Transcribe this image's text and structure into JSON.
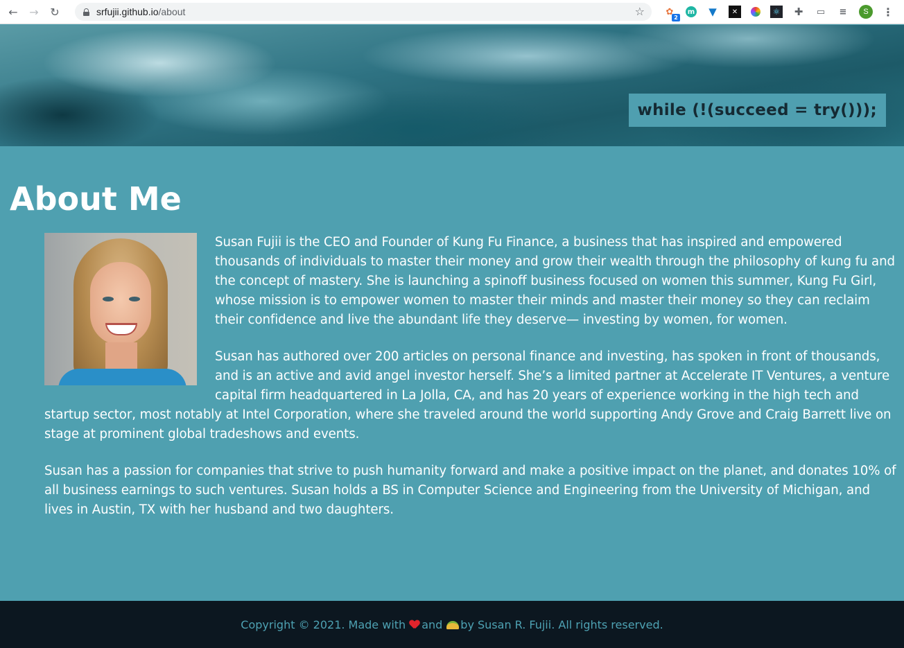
{
  "browser": {
    "back_label": "←",
    "forward_label": "→",
    "reload_label": "↻",
    "url_host": "srfujii.github.io",
    "url_path": "/about",
    "star_icon": "☆",
    "extensions": [
      {
        "name": "extension-1-icon",
        "glyph": "✿",
        "badge": "2"
      },
      {
        "name": "extension-m-icon",
        "glyph": "m"
      },
      {
        "name": "extension-vue-icon",
        "glyph": "▼"
      },
      {
        "name": "extension-x-icon",
        "glyph": "✕"
      },
      {
        "name": "extension-color-icon",
        "glyph": ""
      },
      {
        "name": "extension-react-icon",
        "glyph": "⚛"
      },
      {
        "name": "extensions-puzzle-icon",
        "glyph": "✚"
      },
      {
        "name": "cast-icon",
        "glyph": "▭"
      },
      {
        "name": "media-icon",
        "glyph": "≡"
      }
    ],
    "profile_initial": "S",
    "menu_label": "⋮"
  },
  "header": {
    "motto": "while (!(succeed = try()));"
  },
  "main": {
    "title": "About Me",
    "paragraphs": [
      "Susan Fujii is the CEO and Founder of Kung Fu Finance, a business that has inspired and empowered thousands of individuals to master their money and grow their wealth through the philosophy of kung fu and the concept of mastery. She is launching a spinoff business focused on women this summer, Kung Fu Girl, whose mission is to empower women to master their minds and master their money so they can reclaim their confidence and live the abundant life they deserve— investing by women, for women.",
      "Susan has authored over 200 articles on personal finance and investing, has spoken in front of thousands, and is an active and avid angel investor herself. She’s a limited partner at Accelerate IT Ventures, a venture capital firm headquartered in La Jolla, CA, and has 20 years of experience working in the high tech and startup sector, most notably at Intel Corporation, where she traveled around the world supporting Andy Grove and Craig Barrett live on stage at prominent global tradeshows and events.",
      "Susan has a passion for companies that strive to push humanity forward and make a positive impact on the planet, and donates 10% of all business earnings to such ventures. Susan holds a BS in Computer Science and Engineering from the University of Michigan, and lives in Austin, TX with her husband and two daughters."
    ]
  },
  "footer": {
    "text_before": "Copyright © 2021. Made with",
    "text_middle": "and",
    "text_after": "by Susan R. Fujii. All rights reserved."
  }
}
